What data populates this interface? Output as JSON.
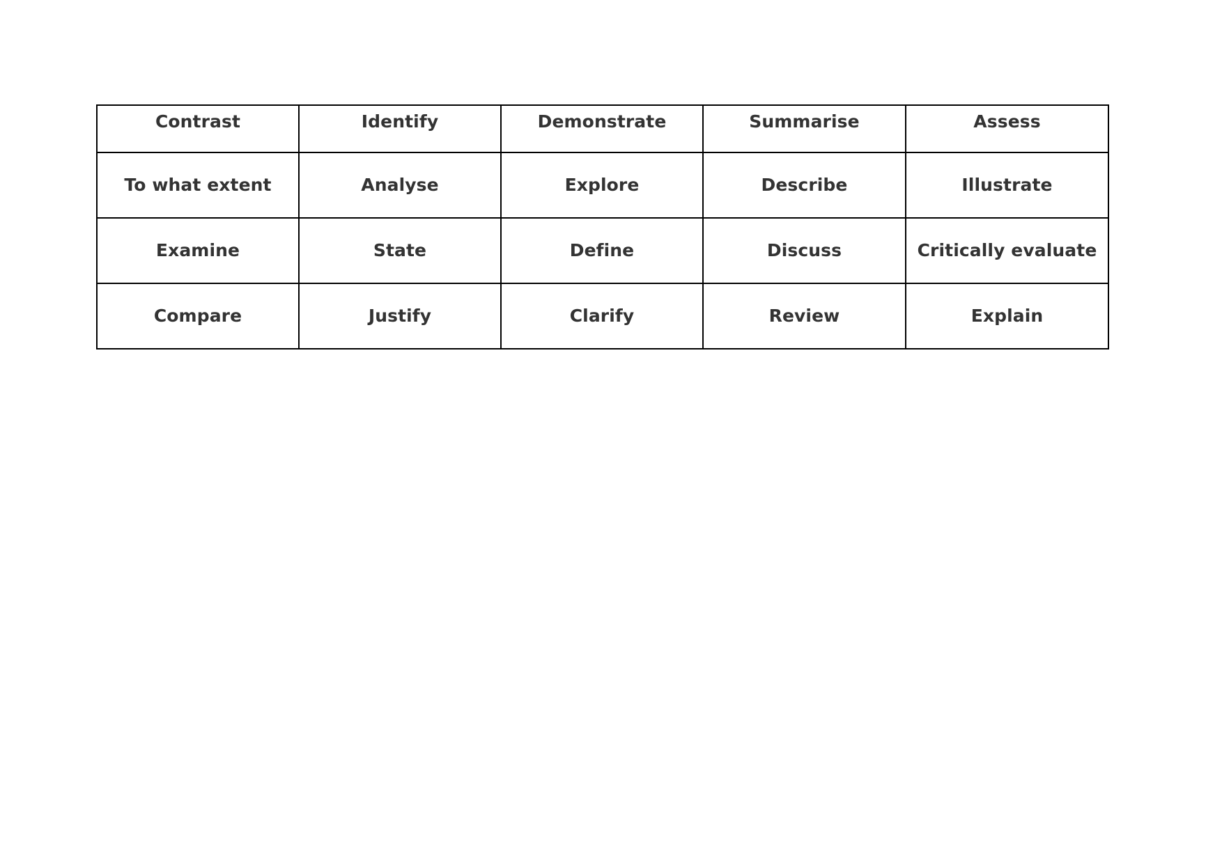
{
  "document": {
    "background_color": "#ffffff",
    "text_color": "#333333",
    "border_color": "#000000"
  },
  "table": {
    "rows": 4,
    "columns": 5,
    "cells": [
      [
        "Contrast",
        "Identify",
        "Demonstrate",
        "Summarise",
        "Assess"
      ],
      [
        "To what extent",
        "Analyse",
        "Explore",
        "Describe",
        "Illustrate"
      ],
      [
        "Examine",
        "State",
        "Define",
        "Discuss",
        "Critically evaluate"
      ],
      [
        "Compare",
        "Justify",
        "Clarify",
        "Review",
        "Explain"
      ]
    ]
  }
}
